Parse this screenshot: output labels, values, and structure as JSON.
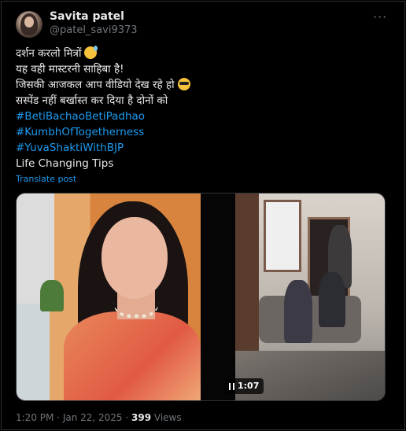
{
  "author": {
    "name": "Savita patel",
    "handle": "@patel_savi9373"
  },
  "more_menu": "···",
  "post": {
    "lines": [
      "दर्शन करलो मित्रों",
      "यह वही मास्टरनी साहिबा है!",
      " जिसकी आजकल आप वीडियो देख रहे हो",
      "सस्पेंड नहीं बर्खास्त कर दिया है  दोनों को"
    ],
    "hashtags": [
      "#BetiBachaoBetiPadhao",
      "#KumbhOfTogetherness",
      "#YuvaShaktiWithBJP"
    ],
    "closing": "Life Changing Tips",
    "emojis": [
      "sweat-smile-icon",
      "sunglasses-face-icon"
    ]
  },
  "translate": "Translate post",
  "media": {
    "duration": "1:07"
  },
  "meta": {
    "time": "1:20 PM",
    "separator": " · ",
    "date": "Jan 22, 2025",
    "views_count": "399",
    "views_label": " Views"
  },
  "colors": {
    "background": "#000000",
    "text": "#e7e9ea",
    "secondary": "#71767b",
    "link": "#1d9bf0",
    "border": "#2f3336"
  }
}
